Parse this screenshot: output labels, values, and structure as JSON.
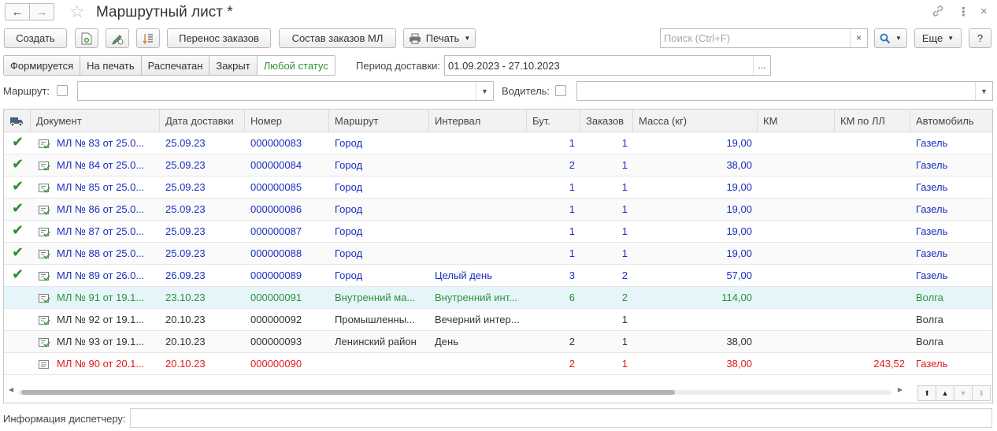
{
  "window": {
    "title": "Маршрутный лист *",
    "icons": [
      "arrow-left-icon",
      "arrow-right-icon",
      "star-icon",
      "link-icon",
      "kebab-menu-icon",
      "close-icon"
    ]
  },
  "toolbar": {
    "create_label": "Создать",
    "transfer_orders_label": "Перенос заказов",
    "orders_ml_label": "Состав заказов МЛ",
    "print_label": "Печать",
    "search_placeholder": "Поиск (Ctrl+F)",
    "search_clear": "×",
    "search_find": "🔍",
    "more_label": "Еще",
    "help_label": "?"
  },
  "status_filter": {
    "tabs": [
      "Формируется",
      "На печать",
      "Распечатан",
      "Закрыт",
      "Любой статус"
    ],
    "active_index": 4,
    "period_label": "Период доставки:",
    "period_value": "01.09.2023 - 27.10.2023",
    "period_btn": "..."
  },
  "filters": {
    "route_label": "Маршрут:",
    "route_value": "",
    "driver_label": "Водитель:",
    "driver_value": ""
  },
  "table": {
    "columns": [
      "Документ",
      "Дата доставки",
      "Номер",
      "Маршрут",
      "Интервал",
      "Бут.",
      "Заказов",
      "Масса (кг)",
      "КМ",
      "КМ по ЛЛ",
      "Автомобиль"
    ],
    "rows": [
      {
        "checked": true,
        "doc": "МЛ № 83 от 25.0...",
        "date": "25.09.23",
        "number": "000000083",
        "route": "Город",
        "interval": "",
        "but": "1",
        "orders": "1",
        "mass": "19,00",
        "km": "",
        "km_ll": "",
        "car": "Газель",
        "color": "#1a2fbf"
      },
      {
        "checked": true,
        "doc": "МЛ № 84 от 25.0...",
        "date": "25.09.23",
        "number": "000000084",
        "route": "Город",
        "interval": "",
        "but": "2",
        "orders": "1",
        "mass": "38,00",
        "km": "",
        "km_ll": "",
        "car": "Газель",
        "color": "#1a2fbf"
      },
      {
        "checked": true,
        "doc": "МЛ № 85 от 25.0...",
        "date": "25.09.23",
        "number": "000000085",
        "route": "Город",
        "interval": "",
        "but": "1",
        "orders": "1",
        "mass": "19,00",
        "km": "",
        "km_ll": "",
        "car": "Газель",
        "color": "#1a2fbf"
      },
      {
        "checked": true,
        "doc": "МЛ № 86 от 25.0...",
        "date": "25.09.23",
        "number": "000000086",
        "route": "Город",
        "interval": "",
        "but": "1",
        "orders": "1",
        "mass": "19,00",
        "km": "",
        "km_ll": "",
        "car": "Газель",
        "color": "#1a2fbf"
      },
      {
        "checked": true,
        "doc": "МЛ № 87 от 25.0...",
        "date": "25.09.23",
        "number": "000000087",
        "route": "Город",
        "interval": "",
        "but": "1",
        "orders": "1",
        "mass": "19,00",
        "km": "",
        "km_ll": "",
        "car": "Газель",
        "color": "#1a2fbf"
      },
      {
        "checked": true,
        "doc": "МЛ № 88 от 25.0...",
        "date": "25.09.23",
        "number": "000000088",
        "route": "Город",
        "interval": "",
        "but": "1",
        "orders": "1",
        "mass": "19,00",
        "km": "",
        "km_ll": "",
        "car": "Газель",
        "color": "#1a2fbf"
      },
      {
        "checked": true,
        "doc": "МЛ № 89 от 26.0...",
        "date": "26.09.23",
        "number": "000000089",
        "route": "Город",
        "interval": "Целый день",
        "but": "3",
        "orders": "2",
        "mass": "57,00",
        "km": "",
        "km_ll": "",
        "car": "Газель",
        "color": "#1a2fbf"
      },
      {
        "checked": false,
        "doc": "МЛ № 91 от 19.1...",
        "date": "23.10.23",
        "number": "000000091",
        "route": "Внутренний ма...",
        "interval": "Внутренний инт...",
        "but": "6",
        "orders": "2",
        "mass": "114,00",
        "km": "",
        "km_ll": "",
        "car": "Волга",
        "color": "#2d9138",
        "selected": true
      },
      {
        "checked": false,
        "doc": "МЛ № 92 от 19.1...",
        "date": "20.10.23",
        "number": "000000092",
        "route": "Промышленны...",
        "interval": "Вечерний интер...",
        "but": "",
        "orders": "1",
        "mass": "",
        "km": "",
        "km_ll": "",
        "car": "Волга",
        "color": "#333333"
      },
      {
        "checked": false,
        "doc": "МЛ № 93 от 19.1...",
        "date": "20.10.23",
        "number": "000000093",
        "route": "Ленинский район",
        "interval": "День",
        "but": "2",
        "orders": "1",
        "mass": "38,00",
        "km": "",
        "km_ll": "",
        "car": "Волга",
        "color": "#333333"
      },
      {
        "checked": false,
        "doc": "МЛ № 90 от 20.1...",
        "date": "20.10.23",
        "number": "000000090",
        "route": "",
        "interval": "",
        "but": "2",
        "orders": "1",
        "mass": "38,00",
        "km": "",
        "km_ll": "243,52",
        "car": "Газель",
        "color": "#e01b1b",
        "plain_icon": true
      }
    ]
  },
  "footer": {
    "info_label": "Информация диспетчеру:",
    "info_value": ""
  }
}
